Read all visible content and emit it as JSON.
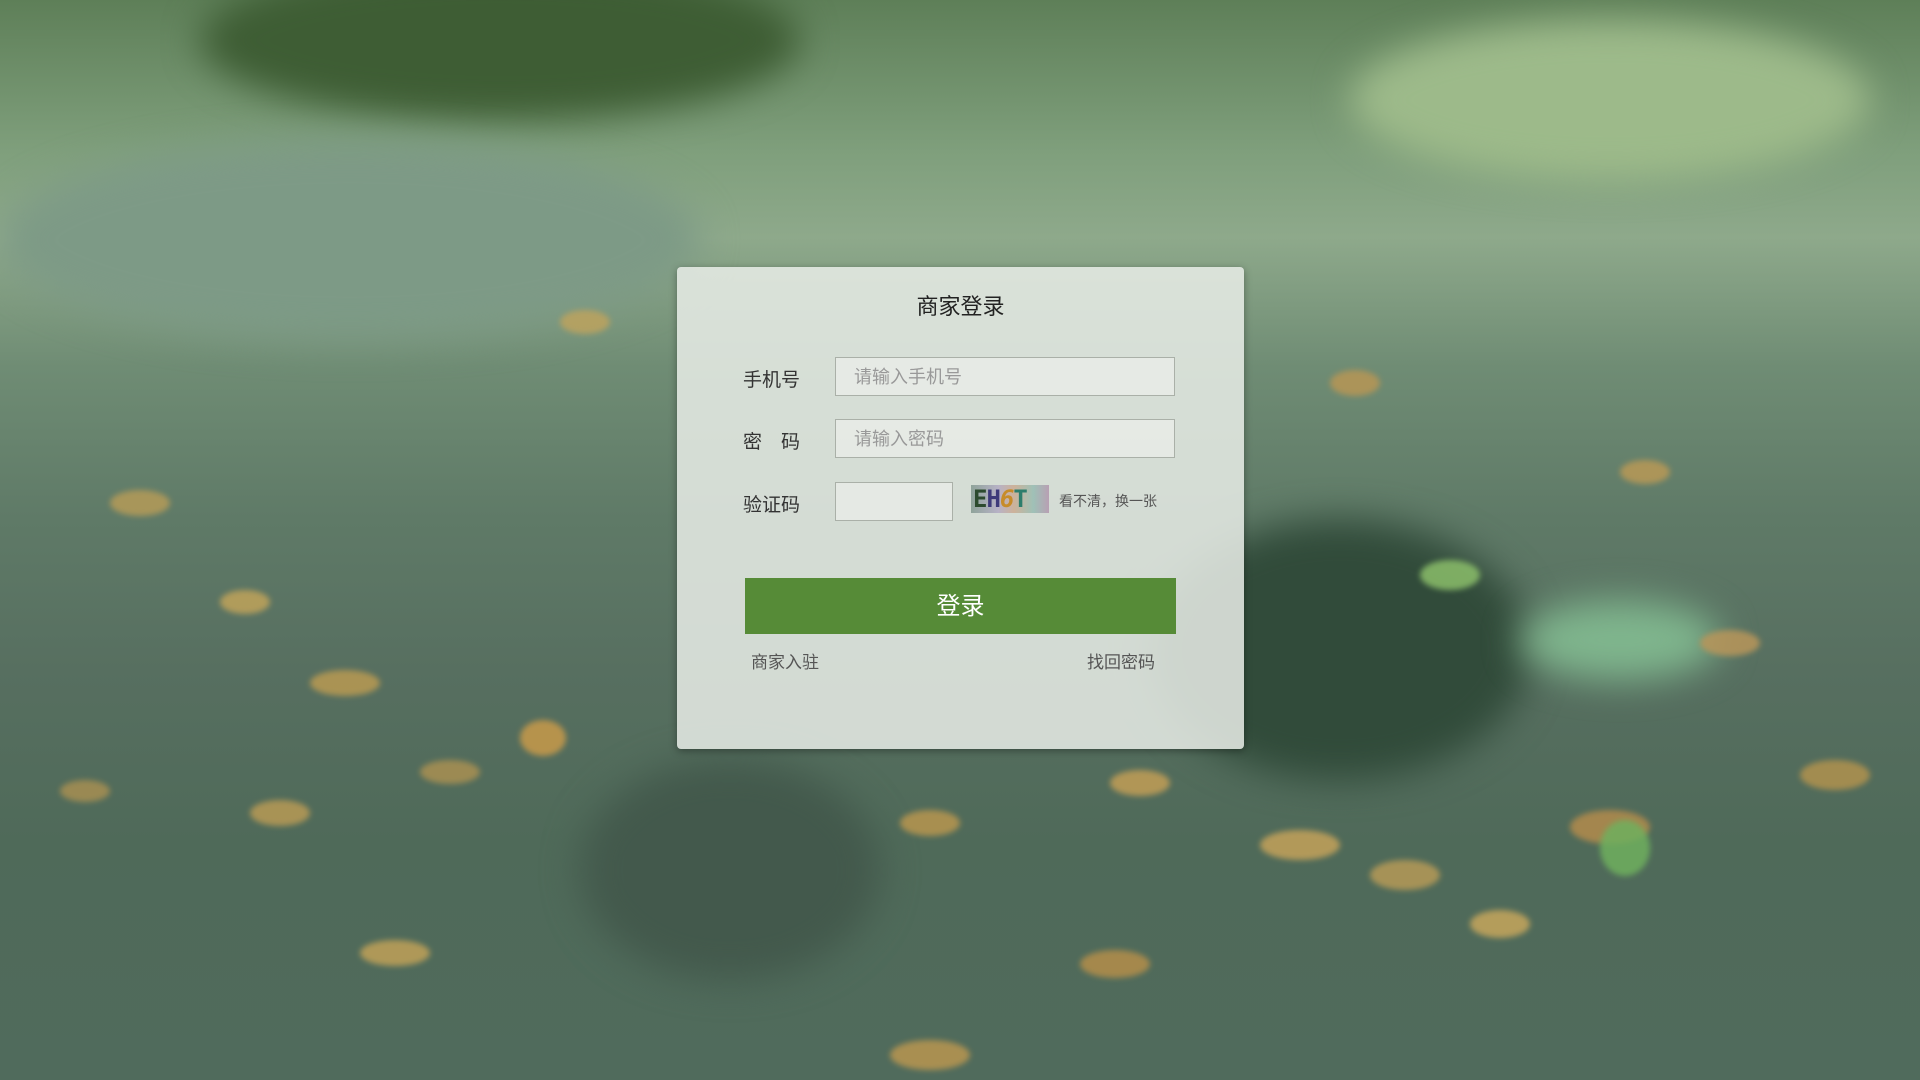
{
  "login": {
    "title": "商家登录",
    "phone_label": "手机号",
    "phone_placeholder": "请输入手机号",
    "password_label": "密　码",
    "password_placeholder": "请输入密码",
    "captcha_label": "验证码",
    "captcha_value": "",
    "captcha_chars": [
      "E",
      "H",
      "6",
      "T"
    ],
    "captcha_refresh": "看不清，换一张",
    "login_button": "登录",
    "register_link": "商家入驻",
    "forgot_link": "找回密码"
  },
  "colors": {
    "accent": "#568b37"
  }
}
